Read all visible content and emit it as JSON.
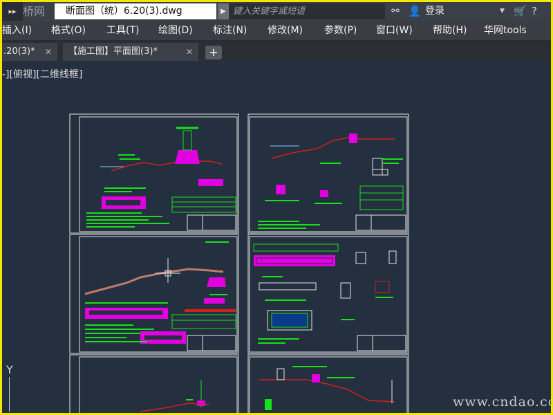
{
  "titlebar": {
    "quick_access": "▸▸",
    "logo": "桥网",
    "file_name": "断面图（统）6.20(3).dwg",
    "search_placeholder": "键入关键字或短语",
    "login_label": "登录",
    "icons": [
      "binoculars-icon",
      "user-icon",
      "cart-icon",
      "help-icon"
    ]
  },
  "menu": {
    "items": [
      "插入(I)",
      "格式(O)",
      "工具(T)",
      "绘图(D)",
      "标注(N)",
      "修改(M)",
      "参数(P)",
      "窗口(W)",
      "帮助(H)",
      "华网tools"
    ]
  },
  "tabs": {
    "items": [
      {
        "label": ".20(3)*"
      },
      {
        "label": "【施工图】平面图(3)*"
      }
    ]
  },
  "viewport": {
    "label": "-][俯视][二维线框]",
    "ucs_axis": "Y"
  },
  "watermark": "www.cndao.com",
  "colors": {
    "background": "#243040",
    "drawing_green": "#18e018",
    "drawing_magenta": "#e000e0",
    "drawing_red": "#d02020",
    "frame_yellow": "#f5e600"
  }
}
